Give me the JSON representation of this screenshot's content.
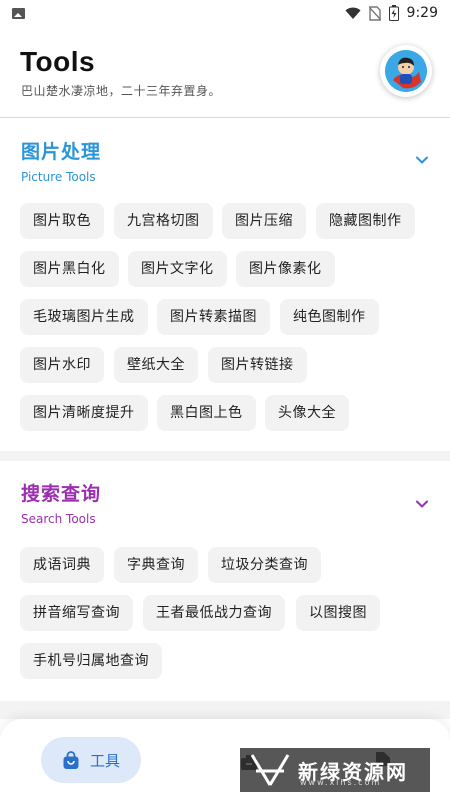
{
  "status_bar": {
    "time": "9:29",
    "icons": [
      "image-icon",
      "wifi-icon",
      "no-sim-icon",
      "battery-charging-icon"
    ]
  },
  "header": {
    "title": "Tools",
    "subtitle": "巴山楚水凄凉地，二十三年弃置身。",
    "avatar_icon": "avatar-superhero-icon"
  },
  "sections": [
    {
      "title": "图片处理",
      "subtitle": "Picture Tools",
      "color": "#2a95d9",
      "expanded": true,
      "items": [
        "图片取色",
        "九宫格切图",
        "图片压缩",
        "隐藏图制作",
        "图片黑白化",
        "图片文字化",
        "图片像素化",
        "毛玻璃图片生成",
        "图片转素描图",
        "纯色图制作",
        "图片水印",
        "壁纸大全",
        "图片转链接",
        "图片清晰度提升",
        "黑白图上色",
        "头像大全"
      ]
    },
    {
      "title": "搜索查询",
      "subtitle": "Search Tools",
      "color": "#9b2fae",
      "expanded": true,
      "items": [
        "成语词典",
        "字典查询",
        "垃圾分类查询",
        "拼音缩写查询",
        "王者最低战力查询",
        "以图搜图",
        "手机号归属地查询"
      ]
    }
  ],
  "bottom_nav": {
    "active_label": "工具",
    "active_icon": "bag-icon",
    "active_color": "#2a6fc9"
  },
  "watermark": {
    "text": "新绿资源网",
    "sub": "www.xlhs.com"
  }
}
